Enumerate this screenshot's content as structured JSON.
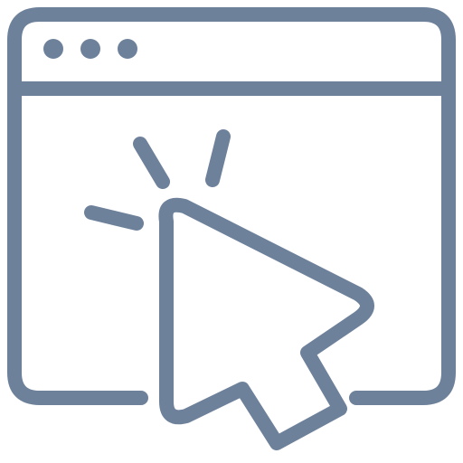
{
  "icon": {
    "name": "browser-click-icon",
    "stroke_color": "#6e819b",
    "background_color": "#ffffff",
    "parts": [
      "browser-window-icon",
      "window-control-dots-icon",
      "mouse-cursor-icon",
      "click-burst-icon"
    ]
  }
}
